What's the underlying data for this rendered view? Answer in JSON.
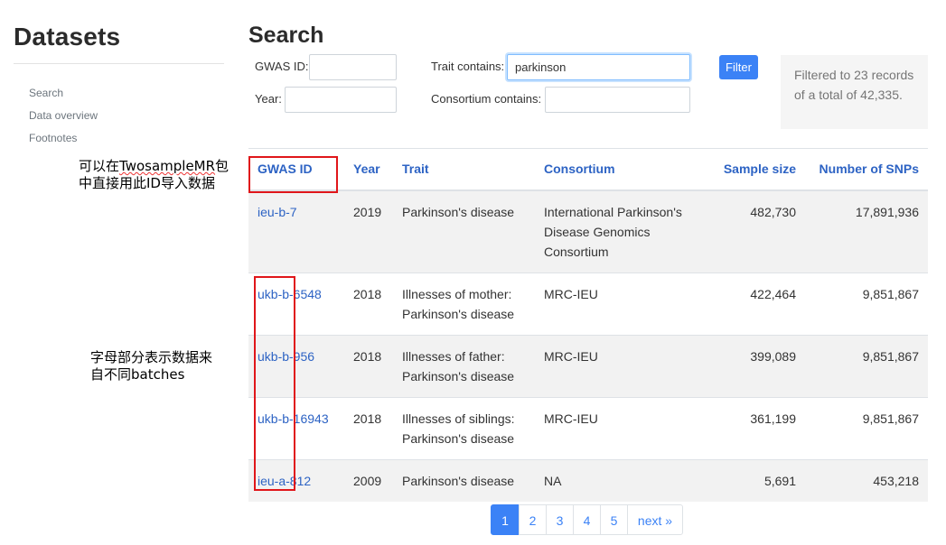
{
  "sidebar": {
    "title": "Datasets",
    "items": [
      "Search",
      "Data overview",
      "Footnotes"
    ]
  },
  "search": {
    "title": "Search",
    "gwas_id_label": "GWAS ID:",
    "gwas_id_value": "",
    "year_label": "Year:",
    "year_value": "",
    "trait_label": "Trait contains:",
    "trait_value": "parkinson",
    "consortium_label": "Consortium contains:",
    "consortium_value": "",
    "filter_button": "Filter",
    "filter_info": "Filtered to 23 records of a total of 42,335."
  },
  "table": {
    "headers": [
      "GWAS ID",
      "Year",
      "Trait",
      "Consortium",
      "Sample size",
      "Number of SNPs"
    ],
    "rows": [
      {
        "id": "ieu-b-7",
        "year": "2019",
        "trait": "Parkinson's disease",
        "consortium": "International Parkinson's Disease Genomics Consortium",
        "sample": "482,730",
        "snps": "17,891,936"
      },
      {
        "id": "ukb-b-6548",
        "year": "2018",
        "trait": "Illnesses of mother: Parkinson's disease",
        "consortium": "MRC-IEU",
        "sample": "422,464",
        "snps": "9,851,867"
      },
      {
        "id": "ukb-b-956",
        "year": "2018",
        "trait": "Illnesses of father: Parkinson's disease",
        "consortium": "MRC-IEU",
        "sample": "399,089",
        "snps": "9,851,867"
      },
      {
        "id": "ukb-b-16943",
        "year": "2018",
        "trait": "Illnesses of siblings: Parkinson's disease",
        "consortium": "MRC-IEU",
        "sample": "361,199",
        "snps": "9,851,867"
      },
      {
        "id": "ieu-a-812",
        "year": "2009",
        "trait": "Parkinson's disease",
        "consortium": "NA",
        "sample": "5,691",
        "snps": "453,218"
      }
    ]
  },
  "pagination": {
    "pages": [
      "1",
      "2",
      "3",
      "4",
      "5"
    ],
    "next": "next »",
    "active": "1"
  },
  "annotations": {
    "note1_line1_a": "可以在",
    "note1_line1_b": "TwosampleMR",
    "note1_line1_c": "包",
    "note1_line2": "中直接用此ID导入数据",
    "note2_line1": "字母部分表示数据来",
    "note2_line2": "自不同batches"
  },
  "colors": {
    "link": "#2d63c4",
    "primary": "#3b82f6",
    "annotation_box": "#e0161a"
  }
}
